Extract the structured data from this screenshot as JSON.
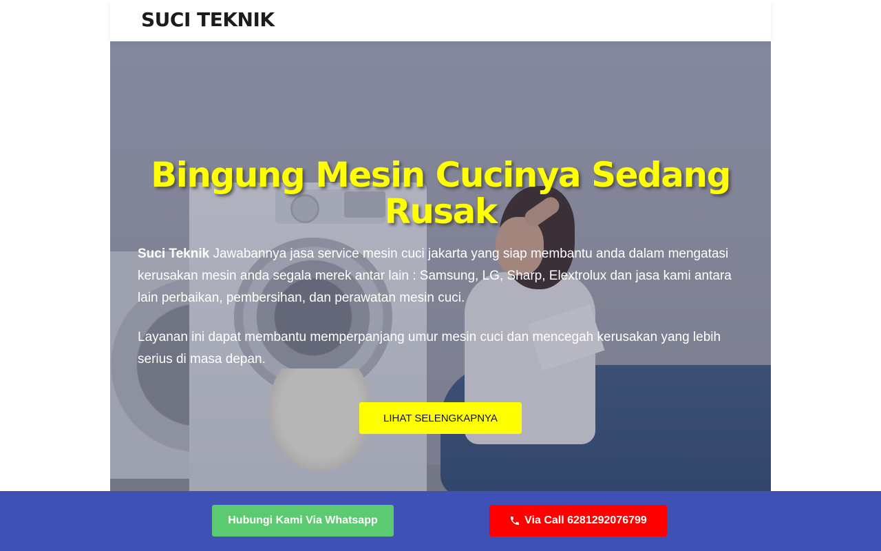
{
  "header": {
    "brand": "SUCI TEKNIK"
  },
  "hero": {
    "title": "Bingung Mesin Cucinya Sedang Rusak",
    "paragraph1_strong": "Suci Teknik",
    "paragraph1_rest": " Jawabannya  jasa service mesin cuci jakarta yang siap membantu anda  dalam mengatasi kerusakan mesin anda segala merek antar lain : Samsung, LG, Sharp, Elextrolux dan jasa kami antara lain perbaikan, pembersihan, dan perawatan mesin cuci.",
    "paragraph2": "Layanan ini dapat membantu memperpanjang umur mesin cuci dan mencegah kerusakan yang lebih serius di masa depan.",
    "cta_label": "LIHAT SELENGKAPNYA",
    "title_color": "#ffff00",
    "cta_color": "#ffff00"
  },
  "bottom_bar": {
    "whatsapp_label": "Hubungi Kami Via Whatsapp",
    "call_label": "Via Call 6281292076799",
    "call_icon": "phone-icon",
    "bar_color": "#3f51b5",
    "whatsapp_color": "#5cca70",
    "call_color": "#ff0000"
  }
}
